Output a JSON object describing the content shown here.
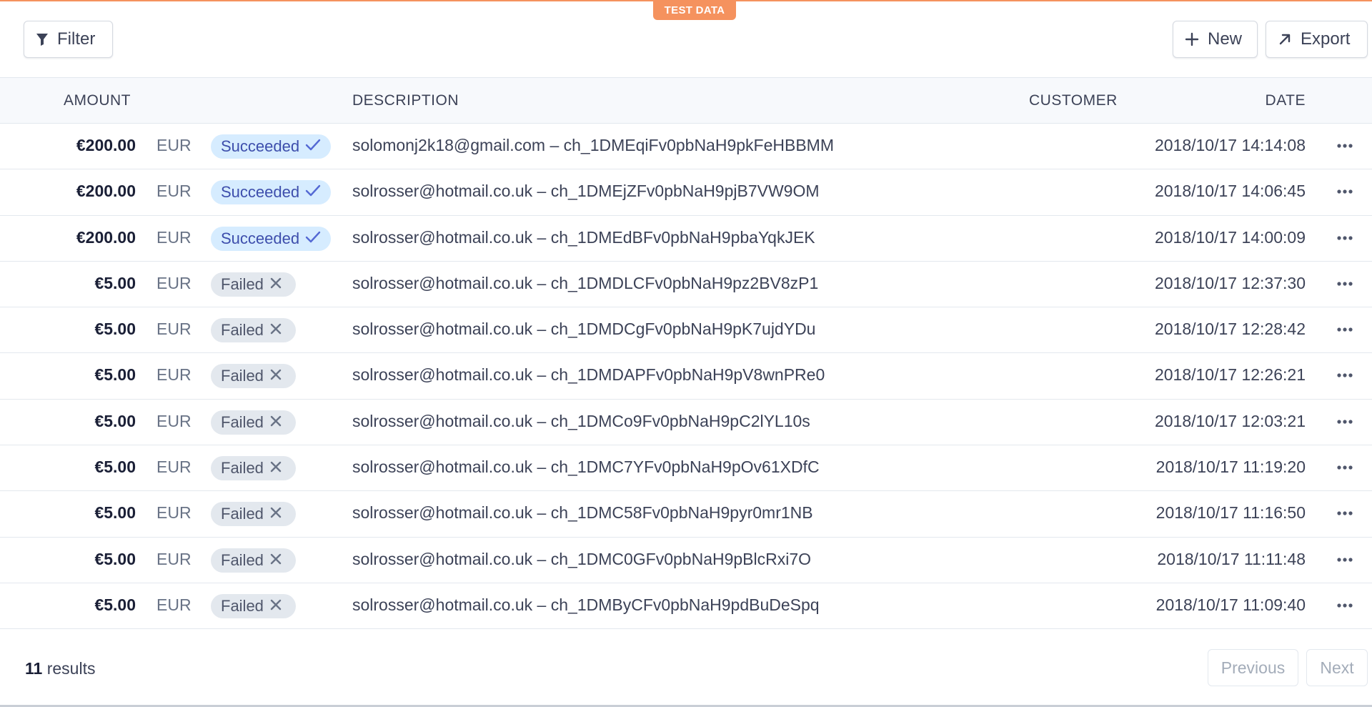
{
  "banner": {
    "label": "TEST DATA"
  },
  "toolbar": {
    "filter_label": "Filter",
    "new_label": "New",
    "export_label": "Export"
  },
  "table": {
    "columns": {
      "amount": "AMOUNT",
      "description": "DESCRIPTION",
      "customer": "CUSTOMER",
      "date": "DATE"
    },
    "rows": [
      {
        "amount": "€200.00",
        "currency": "EUR",
        "status": "Succeeded",
        "description": "solomonj2k18@gmail.com – ch_1DMEqiFv0pbNaH9pkFeHBBMM",
        "date": "2018/10/17 14:14:08"
      },
      {
        "amount": "€200.00",
        "currency": "EUR",
        "status": "Succeeded",
        "description": "solrosser@hotmail.co.uk – ch_1DMEjZFv0pbNaH9pjB7VW9OM",
        "date": "2018/10/17 14:06:45"
      },
      {
        "amount": "€200.00",
        "currency": "EUR",
        "status": "Succeeded",
        "description": "solrosser@hotmail.co.uk – ch_1DMEdBFv0pbNaH9pbaYqkJEK",
        "date": "2018/10/17 14:00:09"
      },
      {
        "amount": "€5.00",
        "currency": "EUR",
        "status": "Failed",
        "description": "solrosser@hotmail.co.uk – ch_1DMDLCFv0pbNaH9pz2BV8zP1",
        "date": "2018/10/17 12:37:30"
      },
      {
        "amount": "€5.00",
        "currency": "EUR",
        "status": "Failed",
        "description": "solrosser@hotmail.co.uk – ch_1DMDCgFv0pbNaH9pK7ujdYDu",
        "date": "2018/10/17 12:28:42"
      },
      {
        "amount": "€5.00",
        "currency": "EUR",
        "status": "Failed",
        "description": "solrosser@hotmail.co.uk – ch_1DMDAPFv0pbNaH9pV8wnPRe0",
        "date": "2018/10/17 12:26:21"
      },
      {
        "amount": "€5.00",
        "currency": "EUR",
        "status": "Failed",
        "description": "solrosser@hotmail.co.uk – ch_1DMCo9Fv0pbNaH9pC2lYL10s",
        "date": "2018/10/17 12:03:21"
      },
      {
        "amount": "€5.00",
        "currency": "EUR",
        "status": "Failed",
        "description": "solrosser@hotmail.co.uk – ch_1DMC7YFv0pbNaH9pOv61XDfC",
        "date": "2018/10/17 11:19:20"
      },
      {
        "amount": "€5.00",
        "currency": "EUR",
        "status": "Failed",
        "description": "solrosser@hotmail.co.uk – ch_1DMC58Fv0pbNaH9pyr0mr1NB",
        "date": "2018/10/17 11:16:50"
      },
      {
        "amount": "€5.00",
        "currency": "EUR",
        "status": "Failed",
        "description": "solrosser@hotmail.co.uk – ch_1DMC0GFv0pbNaH9pBlcRxi7O",
        "date": "2018/10/17 11:11:48"
      },
      {
        "amount": "€5.00",
        "currency": "EUR",
        "status": "Failed",
        "description": "solrosser@hotmail.co.uk – ch_1DMByCFv0pbNaH9pdBuDeSpq",
        "date": "2018/10/17 11:09:40"
      }
    ]
  },
  "footer": {
    "result_count": "11",
    "result_label": "results",
    "previous_label": "Previous",
    "next_label": "Next"
  },
  "colors": {
    "test_banner": "#f5925e",
    "succeeded_bg": "#d6ecff",
    "succeeded_fg": "#3d4eac",
    "failed_bg": "#e3e8ee",
    "failed_fg": "#4f566b"
  },
  "icons": {
    "filter": "filter-icon",
    "new": "plus-icon",
    "export": "arrow-up-right-icon",
    "succeeded": "check-icon",
    "failed": "x-icon",
    "row_menu": "more-horizontal-icon"
  }
}
